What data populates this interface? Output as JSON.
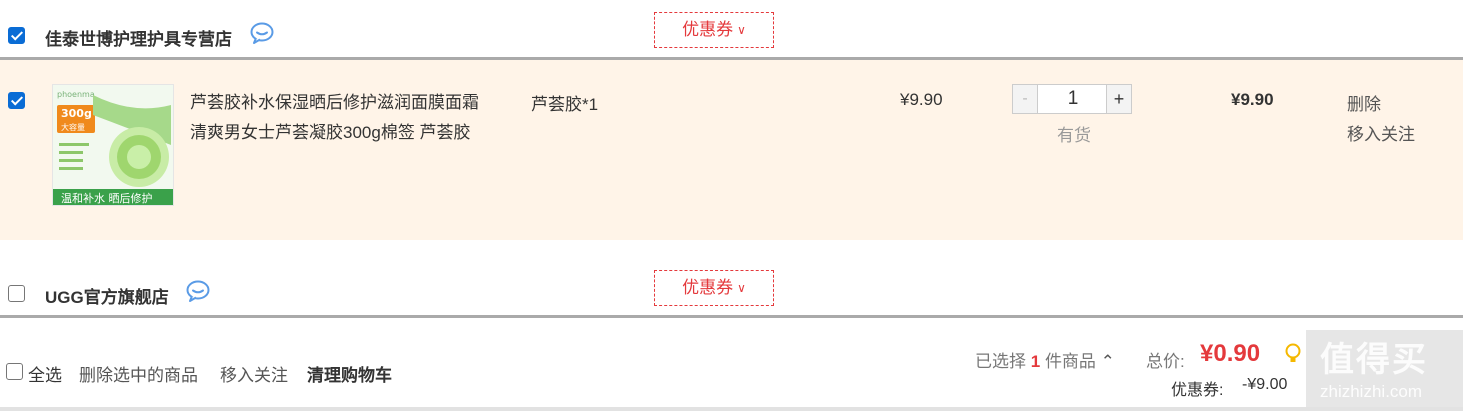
{
  "stores": [
    {
      "name": "佳泰世博护理护具专营店",
      "coupon_label": "优惠券",
      "checked": true
    },
    {
      "name": "UGG官方旗舰店",
      "coupon_label": "优惠券",
      "checked": false
    }
  ],
  "item": {
    "title_line1": "芦荟胶补水保湿晒后修护滋润面膜面霜",
    "title_line2": "清爽男女士芦荟凝胶300g棉签 芦荟胶",
    "spec": "芦荟胶*1",
    "unit_price": "¥9.90",
    "quantity": "1",
    "qty_minus": "-",
    "qty_plus": "+",
    "stock_status": "有货",
    "subtotal": "¥9.90",
    "delete_label": "删除",
    "move_to_favorites_label": "移入关注",
    "thumb": {
      "brand": "phoenma",
      "badge_top": "300g",
      "badge_bottom": "大容量",
      "banner": "温和补水 晒后修护"
    }
  },
  "footer": {
    "select_all_label": "全选",
    "delete_selected_label": "删除选中的商品",
    "move_to_favorites_label": "移入关注",
    "clear_cart_label": "清理购物车",
    "selected_prefix": "已选择",
    "selected_count": "1",
    "selected_suffix": "件商品",
    "total_label": "总价:",
    "total_value": "¥0.90",
    "coupon_label": "优惠券:",
    "coupon_value": "-¥9.00"
  },
  "watermark": {
    "text_top": "值得买",
    "text_bottom": "zhizhizhi.com"
  },
  "colors": {
    "accent_red": "#e4393c",
    "checkbox_blue": "#0a6cd5",
    "item_bg": "#fff4e8",
    "chat_blue": "#5a9be6"
  }
}
